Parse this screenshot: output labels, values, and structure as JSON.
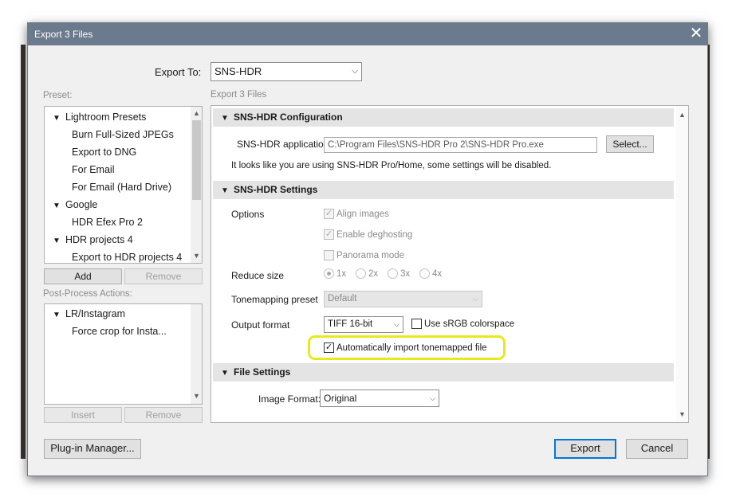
{
  "dialog": {
    "title": "Export 3 Files",
    "close_glyph": "✕"
  },
  "export_to": {
    "label": "Export To:",
    "value": "SNS-HDR"
  },
  "preset": {
    "label": "Preset:",
    "items": [
      {
        "text": "Lightroom Presets",
        "group": true
      },
      {
        "text": "Burn Full-Sized JPEGs",
        "group": false
      },
      {
        "text": "Export to DNG",
        "group": false
      },
      {
        "text": "For Email",
        "group": false
      },
      {
        "text": "For Email (Hard Drive)",
        "group": false
      },
      {
        "text": "Google",
        "group": true
      },
      {
        "text": "HDR Efex Pro 2",
        "group": false
      },
      {
        "text": "HDR projects 4",
        "group": true
      },
      {
        "text": "Export to HDR projects 4",
        "group": false
      }
    ],
    "add_label": "Add",
    "remove_label": "Remove"
  },
  "post_process": {
    "label": "Post-Process Actions:",
    "items": [
      {
        "text": "LR/Instagram",
        "group": true
      },
      {
        "text": "Force crop for Insta...",
        "group": false
      }
    ],
    "insert_label": "Insert",
    "remove_label": "Remove"
  },
  "main": {
    "subtitle": "Export 3 Files",
    "config": {
      "header": "SNS-HDR Configuration",
      "app_label": "SNS-HDR application",
      "app_path": "C:\\Program Files\\SNS-HDR Pro 2\\SNS-HDR Pro.exe",
      "select_label": "Select...",
      "note": "It looks like you are using SNS-HDR Pro/Home, some settings will be disabled."
    },
    "settings": {
      "header": "SNS-HDR Settings",
      "options_label": "Options",
      "align_images": "Align images",
      "enable_deghosting": "Enable deghosting",
      "panorama_mode": "Panorama mode",
      "reduce_size_label": "Reduce size",
      "reduce_options": [
        "1x",
        "2x",
        "3x",
        "4x"
      ],
      "tonemapping_label": "Tonemapping preset",
      "tonemapping_value": "Default",
      "output_format_label": "Output format",
      "output_format_value": "TIFF 16-bit",
      "srgb_label": "Use sRGB colorspace",
      "auto_import_label": "Automatically import tonemapped file"
    },
    "file_settings": {
      "header": "File Settings",
      "image_format_label": "Image Format:",
      "image_format_value": "Original"
    }
  },
  "footer": {
    "plugin_manager_label": "Plug-in Manager...",
    "export_label": "Export",
    "cancel_label": "Cancel"
  },
  "colors": {
    "titlebar": "#6b7a8c",
    "highlight": "#e8e820",
    "focus": "#0078d7"
  },
  "icons": {
    "expand_triangle": "▼",
    "dropdown_chevron": "chevron-down-icon",
    "check": "✓",
    "scroll_up": "▲",
    "scroll_down": "▼"
  }
}
